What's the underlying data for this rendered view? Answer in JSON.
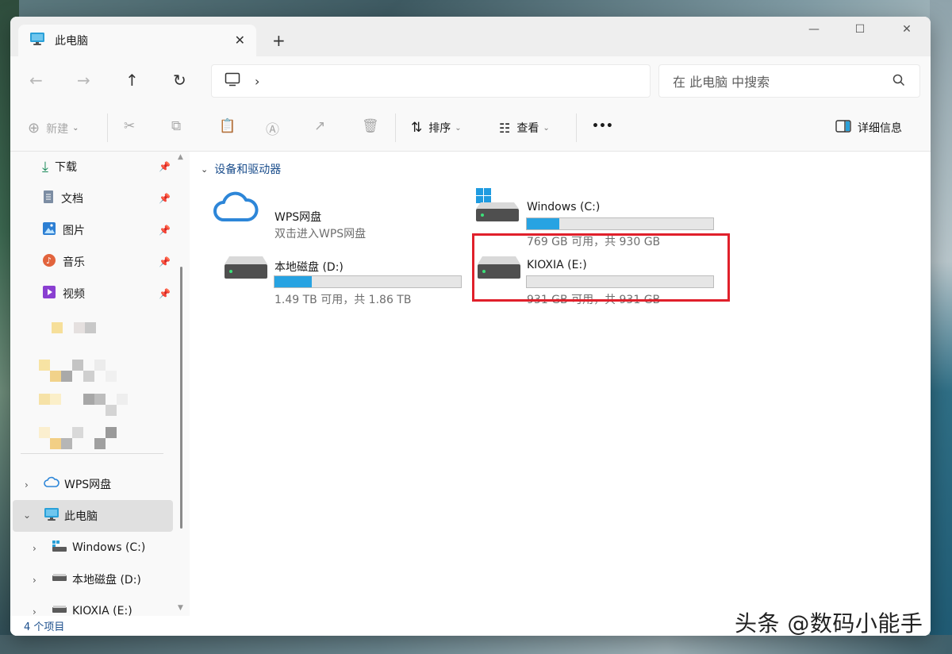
{
  "tab": {
    "title": "此电脑"
  },
  "window_controls": {
    "minimize": "—",
    "maximize": "☐",
    "close": "✕"
  },
  "search": {
    "placeholder": "在 此电脑 中搜索"
  },
  "toolbar": {
    "new_label": "新建",
    "sort_label": "排序",
    "view_label": "查看",
    "more_label": "•••",
    "details_label": "详细信息"
  },
  "sidebar": {
    "quick_access": [
      {
        "label": "下载",
        "icon": "download-icon"
      },
      {
        "label": "文档",
        "icon": "document-icon"
      },
      {
        "label": "图片",
        "icon": "pictures-icon"
      },
      {
        "label": "音乐",
        "icon": "music-icon"
      },
      {
        "label": "视频",
        "icon": "video-icon"
      }
    ],
    "wps": "WPS网盘",
    "this_pc": "此电脑",
    "drives": [
      "Windows (C:)",
      "本地磁盘 (D:)",
      "KIOXIA (E:)"
    ]
  },
  "content": {
    "section_title": "设备和驱动器",
    "items": [
      {
        "name": "WPS网盘",
        "subtitle": "双击进入WPS网盘",
        "icon": "cloud-icon"
      },
      {
        "name": "Windows (C:)",
        "subtitle": "769 GB 可用，共 930 GB",
        "usage_fraction": 0.173,
        "icon": "windows-drive-icon"
      },
      {
        "name": "本地磁盘 (D:)",
        "subtitle": "1.49 TB 可用，共 1.86 TB",
        "usage_fraction": 0.199,
        "icon": "drive-icon"
      },
      {
        "name": "KIOXIA (E:)",
        "subtitle": "931 GB 可用，共 931 GB",
        "usage_fraction": 0.0,
        "icon": "drive-icon"
      }
    ]
  },
  "status": {
    "count": "4 个项目"
  },
  "watermark": "头条 @数码小能手",
  "colors": {
    "accent": "#27a3e2",
    "highlight": "#e0202b",
    "link": "#1b4e8c"
  }
}
